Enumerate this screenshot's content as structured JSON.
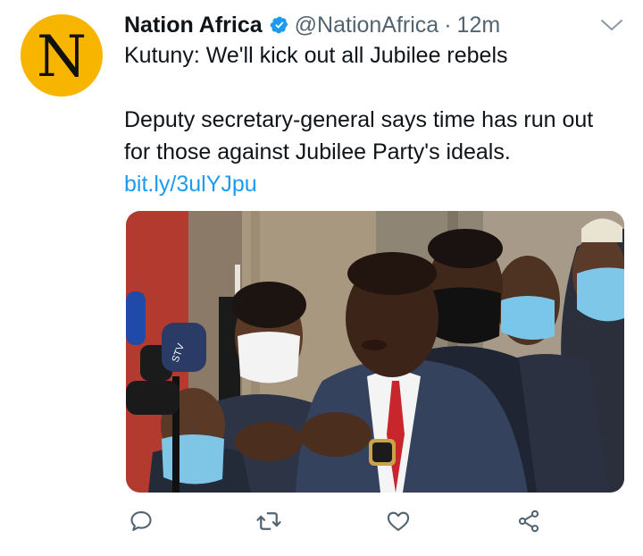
{
  "tweet": {
    "avatar_letter": "N",
    "display_name": "Nation Africa",
    "handle": "@NationAfrica",
    "separator": "·",
    "time": "12m",
    "headline": "Kutuny: We'll kick out all Jubilee rebels",
    "body": "Deputy secretary-general says time has run out for those against Jubilee Party's ideals.",
    "link": "bit.ly/3ulYJpu",
    "microphone_text": "STV"
  },
  "icons": {
    "verified": "verified-badge-icon",
    "more": "chevron-down-icon",
    "reply": "reply-icon",
    "retweet": "retweet-icon",
    "like": "heart-icon",
    "share": "share-icon"
  },
  "colors": {
    "brand_avatar": "#f7b500",
    "verified": "#1d9bf0",
    "link": "#1d9bf0",
    "muted": "#536471"
  }
}
